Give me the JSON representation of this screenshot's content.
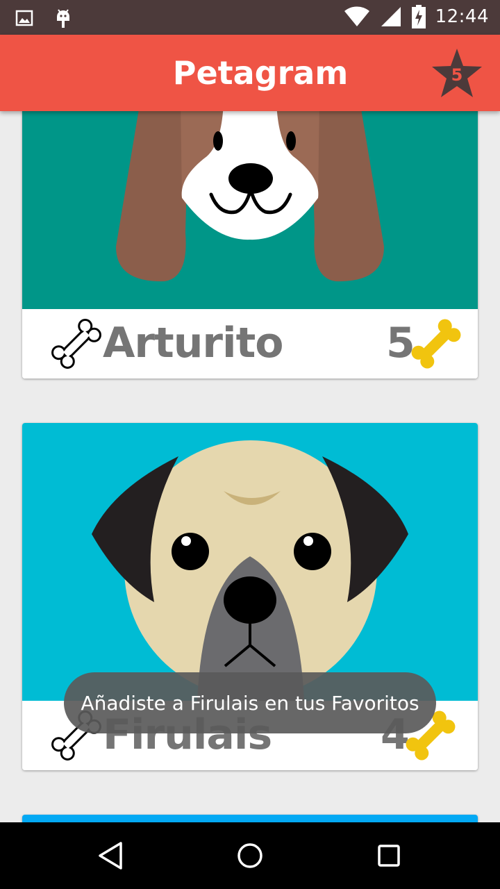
{
  "status_bar": {
    "time": "12:44",
    "icons": [
      "image-notification-icon",
      "android-notification-icon",
      "wifi-icon",
      "signal-icon",
      "battery-charging-icon"
    ]
  },
  "app_bar": {
    "title": "Petagram",
    "favorites_count": "5",
    "colors": {
      "bar": "#ef5445",
      "star": "#4c3a3a"
    }
  },
  "pets": [
    {
      "name": "Arturito",
      "rating": "5",
      "photo": "beagle-illustration",
      "background": "#009688"
    },
    {
      "name": "Firulais",
      "rating": "4",
      "photo": "pug-illustration",
      "background": "#00bcd4"
    },
    {
      "name": "",
      "rating": "",
      "photo": "",
      "background": "#03a9f4"
    }
  ],
  "toast": {
    "message": "Añadiste a Firulais en tus Favoritos"
  },
  "nav_bar": {
    "buttons": [
      "back-icon",
      "home-icon",
      "recents-icon"
    ]
  }
}
